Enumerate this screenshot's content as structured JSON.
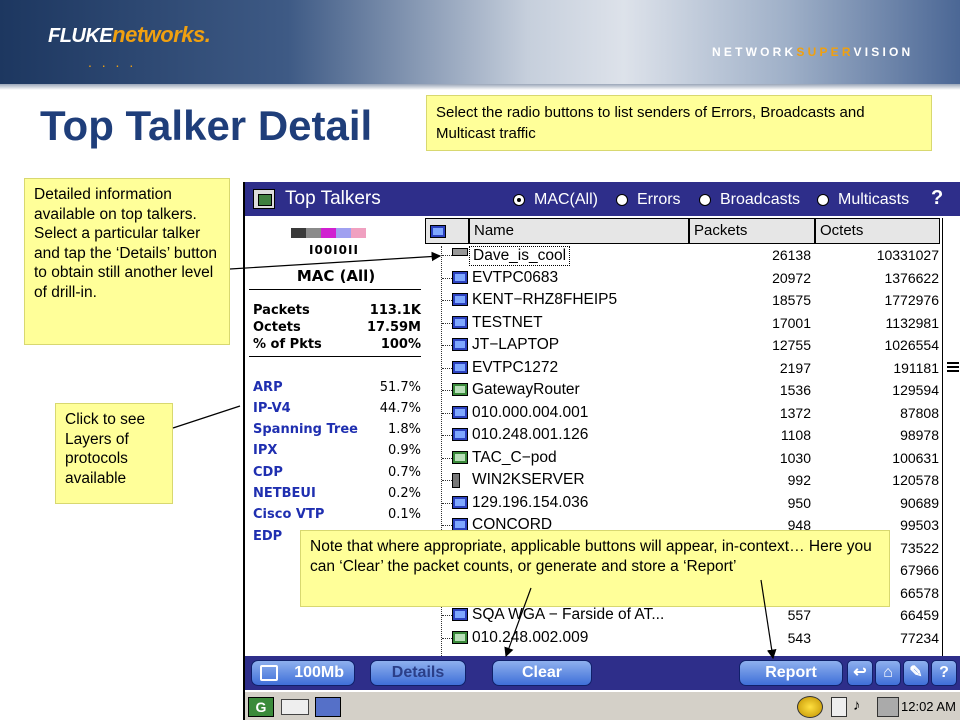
{
  "header": {
    "logo_main": "FLUKE",
    "logo_sub": "networks.",
    "logo_dots": ". . . .",
    "tagline_a": "NETWORK",
    "tagline_b": "SUPER",
    "tagline_c": "VISION",
    "brand_color": "#f0a010"
  },
  "slide_title": "Top Talker Detail",
  "callouts": {
    "radio_hint": "Select the radio buttons to list senders of Errors, Broadcasts and Multicast traffic",
    "details_hint": "Detailed information available on top talkers.  Select a particular talker and tap the ‘Details’ button to obtain still another level of drill-in.",
    "layers_hint": "Click to see Layers of protocols available",
    "context_hint": "Note that where appropriate, applicable buttons will appear, in-context… Here you can ‘Clear’ the packet counts, or generate and store a ‘Report’"
  },
  "device": {
    "window_title": "Top Talkers",
    "radios": [
      {
        "label": "MAC(All)",
        "selected": true
      },
      {
        "label": "Errors",
        "selected": false
      },
      {
        "label": "Broadcasts",
        "selected": false
      },
      {
        "label": "Multicasts",
        "selected": false
      }
    ],
    "help_icon": "?",
    "left_panel": {
      "colors": [
        "#3a3a3a",
        "#8a8a8a",
        "#d020d0",
        "#a0a0f0",
        "#f0a0c0"
      ],
      "bits": "I00I0II",
      "heading": "MAC (All)",
      "stats": [
        {
          "label": "Packets",
          "value": "113.1K"
        },
        {
          "label": "Octets",
          "value": "17.59M"
        },
        {
          "label": "% of Pkts",
          "value": "100%"
        }
      ],
      "protocols": [
        {
          "name": "ARP",
          "pct": "51.7%"
        },
        {
          "name": "IP-V4",
          "pct": "44.7%"
        },
        {
          "name": "Spanning Tree",
          "pct": "1.8%"
        },
        {
          "name": "IPX",
          "pct": "0.9%"
        },
        {
          "name": "CDP",
          "pct": "0.7%"
        },
        {
          "name": "NETBEUI",
          "pct": "0.2%"
        },
        {
          "name": "Cisco VTP",
          "pct": "0.1%"
        },
        {
          "name": "EDP",
          "pct": ""
        }
      ]
    },
    "table": {
      "columns": {
        "name": "Name",
        "packets": "Packets",
        "octets": "Octets"
      },
      "rows": [
        {
          "icon": "nic",
          "name": "Dave_is_cool",
          "packets": "26138",
          "octets": "10331027",
          "selected": true
        },
        {
          "icon": "pc",
          "name": "EVTPC0683",
          "packets": "20972",
          "octets": "1376622"
        },
        {
          "icon": "pc",
          "name": "KENT−RHZ8FHEIP5",
          "packets": "18575",
          "octets": "1772976"
        },
        {
          "icon": "pc",
          "name": "TESTNET",
          "packets": "17001",
          "octets": "1132981"
        },
        {
          "icon": "pc",
          "name": "JT−LAPTOP",
          "packets": "12755",
          "octets": "1026554"
        },
        {
          "icon": "pc",
          "name": "EVTPC1272",
          "packets": "2197",
          "octets": "191181"
        },
        {
          "icon": "router",
          "name": "GatewayRouter",
          "packets": "1536",
          "octets": "129594"
        },
        {
          "icon": "pc",
          "name": "010.000.004.001",
          "packets": "1372",
          "octets": "87808"
        },
        {
          "icon": "pc",
          "name": "010.248.001.126",
          "packets": "1108",
          "octets": "98978"
        },
        {
          "icon": "router",
          "name": "TAC_C−pod",
          "packets": "1030",
          "octets": "100631"
        },
        {
          "icon": "tower",
          "name": "WIN2KSERVER",
          "packets": "992",
          "octets": "120578"
        },
        {
          "icon": "pc",
          "name": "129.196.154.036",
          "packets": "950",
          "octets": "90689"
        },
        {
          "icon": "pc",
          "name": "CONCORD",
          "packets": "948",
          "octets": "99503"
        },
        {
          "icon": "pc",
          "name": "",
          "packets": "",
          "octets": "73522"
        },
        {
          "icon": "pc",
          "name": "",
          "packets": "",
          "octets": "67966"
        },
        {
          "icon": "pc",
          "name": "",
          "packets": "",
          "octets": "66578"
        },
        {
          "icon": "pc",
          "name": "SQA WGA − Farside of AT...",
          "packets": "557",
          "octets": "66459"
        },
        {
          "icon": "router",
          "name": "010.248.002.009",
          "packets": "543",
          "octets": "77234"
        }
      ]
    },
    "bottom_buttons": {
      "speed": "100Mb",
      "details": "Details",
      "clear": "Clear",
      "report": "Report",
      "back_icon": "↩",
      "home_icon": "⌂",
      "tools_icon": "✎",
      "help_icon": "?"
    },
    "taskbar": {
      "start_label": "G",
      "speaker_icon": "♪",
      "clock": "12:02 AM"
    }
  }
}
